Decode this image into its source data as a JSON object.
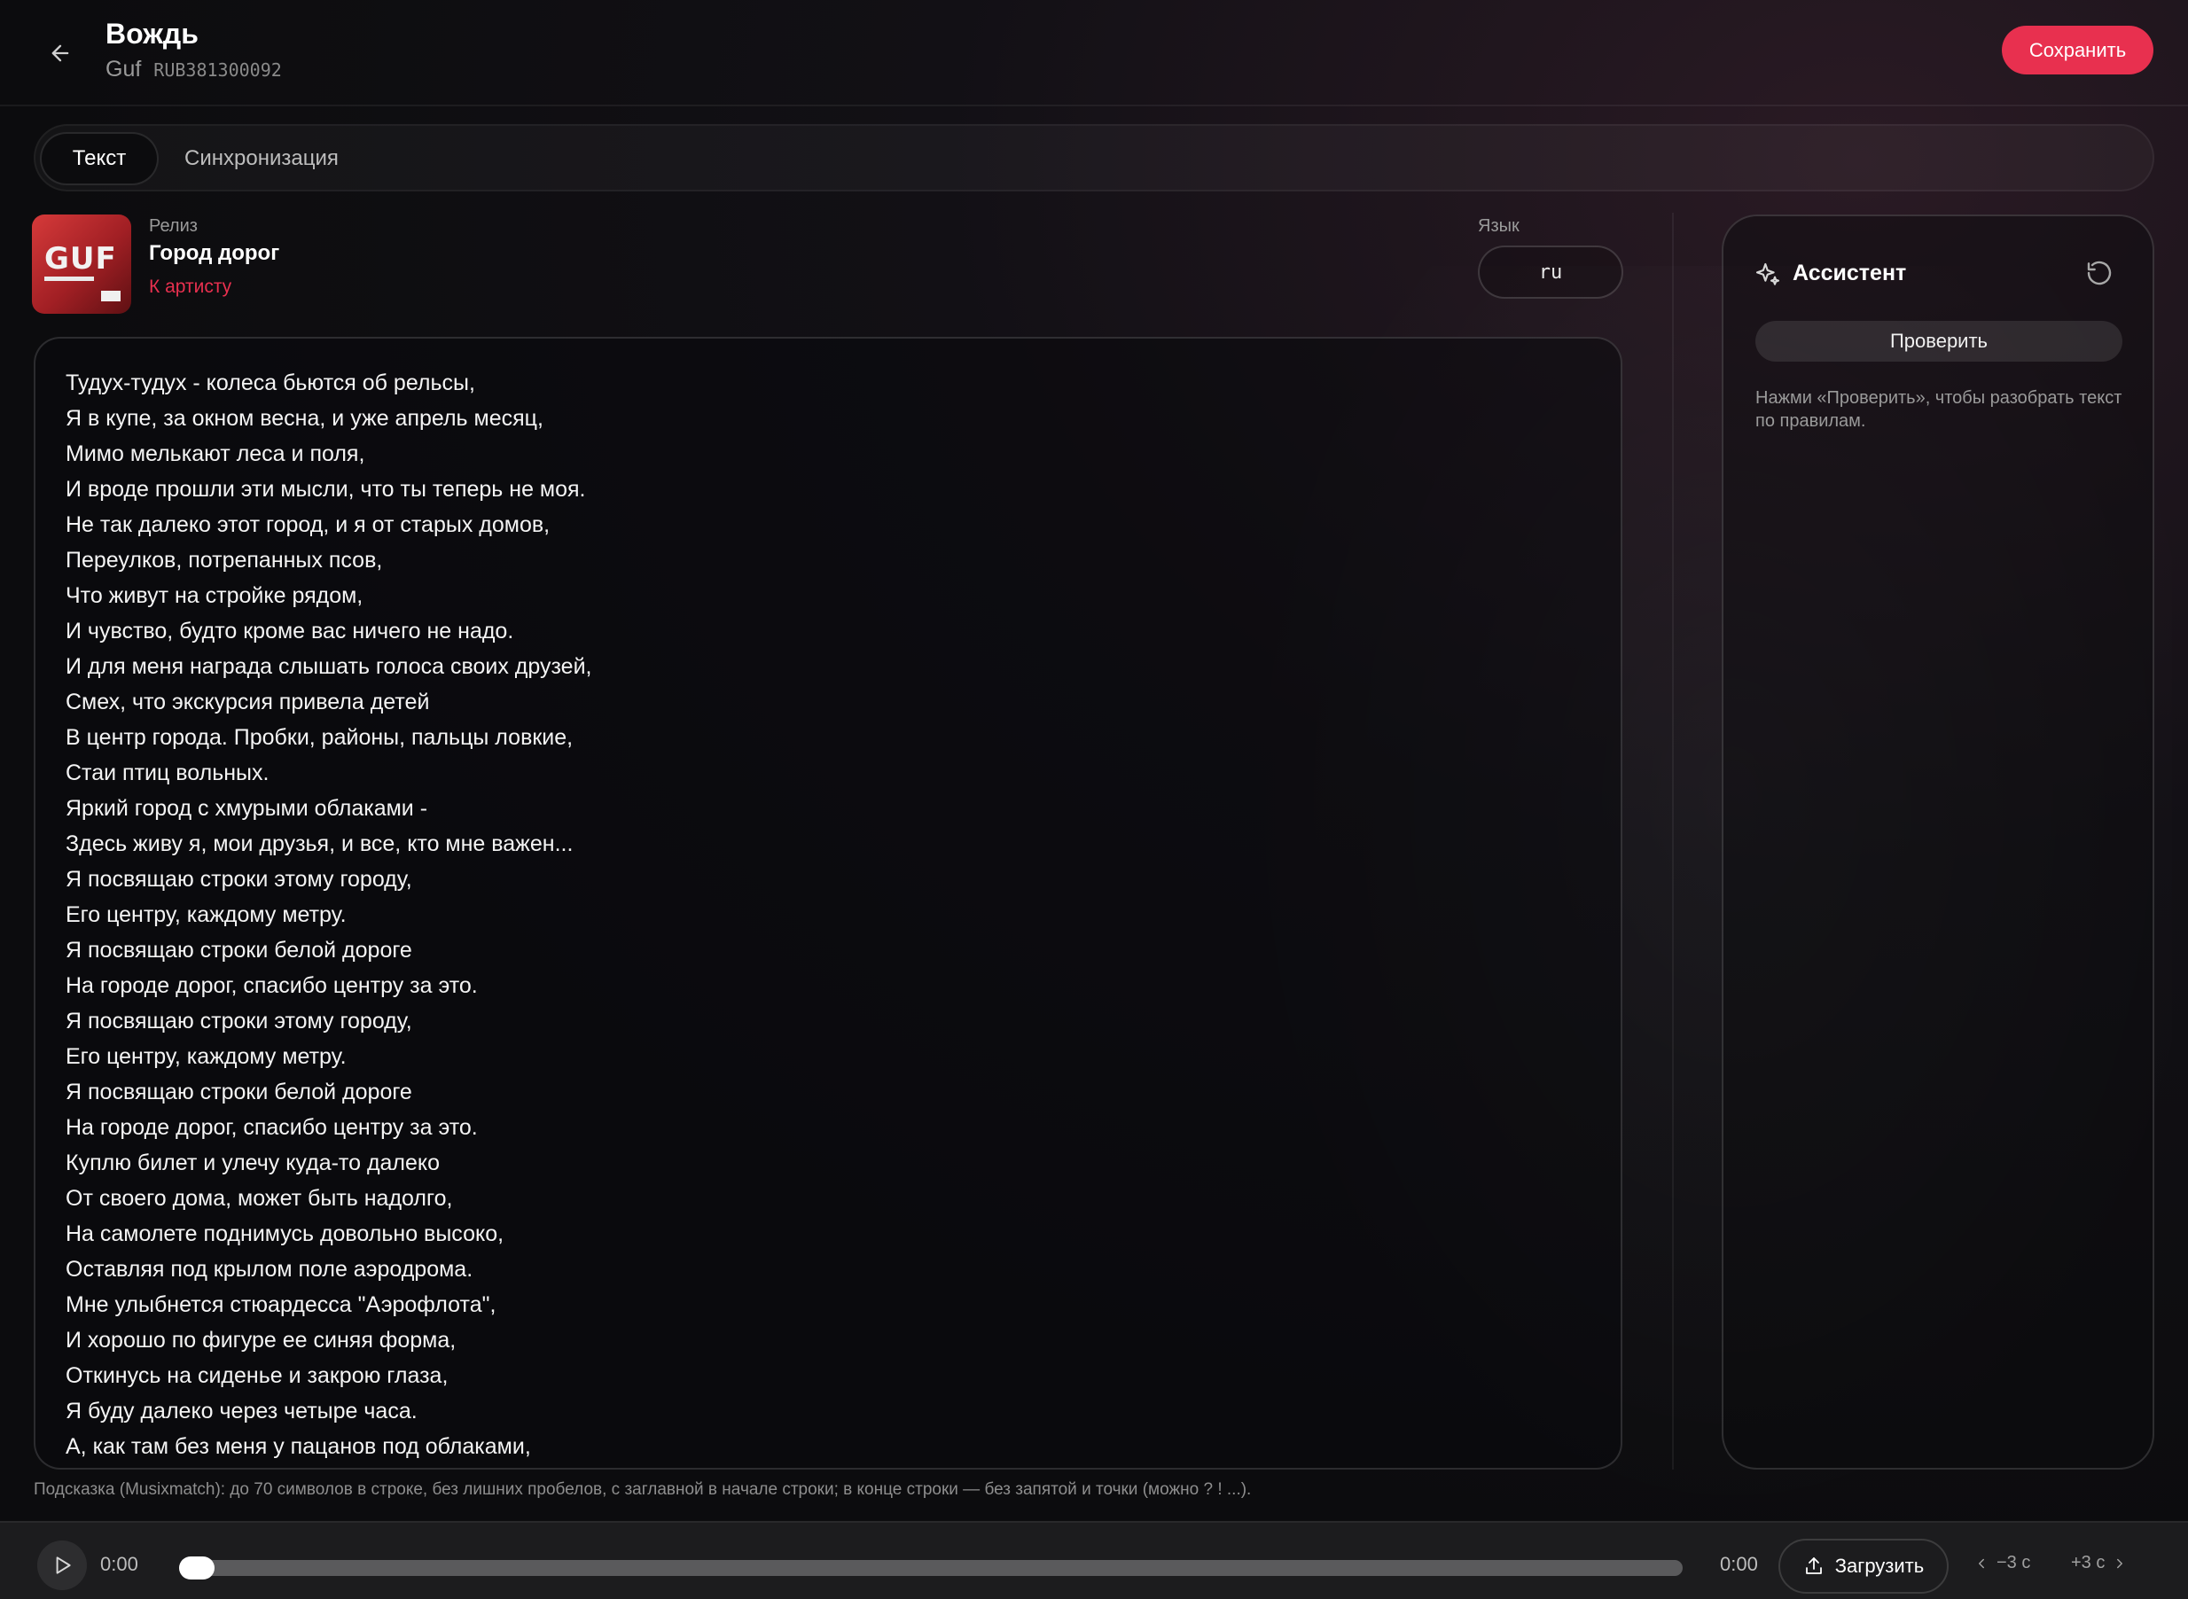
{
  "header": {
    "title": "Вождь",
    "artist": "Guf",
    "isrc": "RUB381300092",
    "save_label": "Сохранить"
  },
  "tabs": [
    {
      "label": "Текст",
      "active": true
    },
    {
      "label": "Синхронизация",
      "active": false
    }
  ],
  "release": {
    "label": "Релиз",
    "name": "Город дорог",
    "artist_link": "К артисту",
    "cover_text": "GUF"
  },
  "language": {
    "label": "Язык",
    "value": "ru"
  },
  "lyrics": "Тудух-тудух - колеса бьются об рельсы,\nЯ в купе, за окном весна, и уже апрель месяц,\nМимо мелькают леса и поля,\nИ вроде прошли эти мысли, что ты теперь не моя.\nНе так далеко этот город, и я от старых домов,\nПереулков, потрепанных псов,\nЧто живут на стройке рядом,\nИ чувство, будто кроме вас ничего не надо.\nИ для меня награда слышать голоса своих друзей,\nСмех, что экскурсия привела детей\nВ центр города. Пробки, районы, пальцы ловкие,\nСтаи птиц вольных.\nЯркий город с хмурыми облаками -\nЗдесь живу я, мои друзья, и все, кто мне важен...\nЯ посвящаю строки этому городу,\nЕго центру, каждому метру.\nЯ посвящаю строки белой дороге\nНа городе дорог, спасибо центру за это.\nЯ посвящаю строки этому городу,\nЕго центру, каждому метру.\nЯ посвящаю строки белой дороге\nНа городе дорог, спасибо центру за это.\nКуплю билет и улечу куда-то далеко\nОт своего дома, может быть надолго,\nНа самолете поднимусь довольно высоко,\nОставляя под крылом поле аэродрома.\nМне улыбнется стюардесса \"Аэрофлота\",\nИ хорошо по фигуре ее синяя форма,\nОткинусь на сиденье и закрою глаза,\nЯ буду далеко через четыре часа.\nА, как там без меня у пацанов под облаками,",
  "assistant": {
    "title": "Ассистент",
    "check_label": "Проверить",
    "hint": "Нажми «Проверить», чтобы разобрать текст по правилам."
  },
  "footer_hint": "Подсказка (Musixmatch): до 70 символов в строке, без лишних пробелов, с заглавной в начале строки; в конце строки — без запятой и точки (можно ? ! ...).",
  "player": {
    "current_time": "0:00",
    "end_time": "0:00",
    "progress": 0,
    "upload_label": "Загрузить",
    "seek_back_label": "−3 с",
    "seek_fwd_label": "+3 с"
  },
  "colors": {
    "accent": "#e8304f",
    "background": "#0c0c0e"
  },
  "icons": [
    "arrow-left-icon",
    "sparkle-icon",
    "refresh-icon",
    "play-icon",
    "upload-icon",
    "chevron-left-icon",
    "chevron-right-icon"
  ]
}
